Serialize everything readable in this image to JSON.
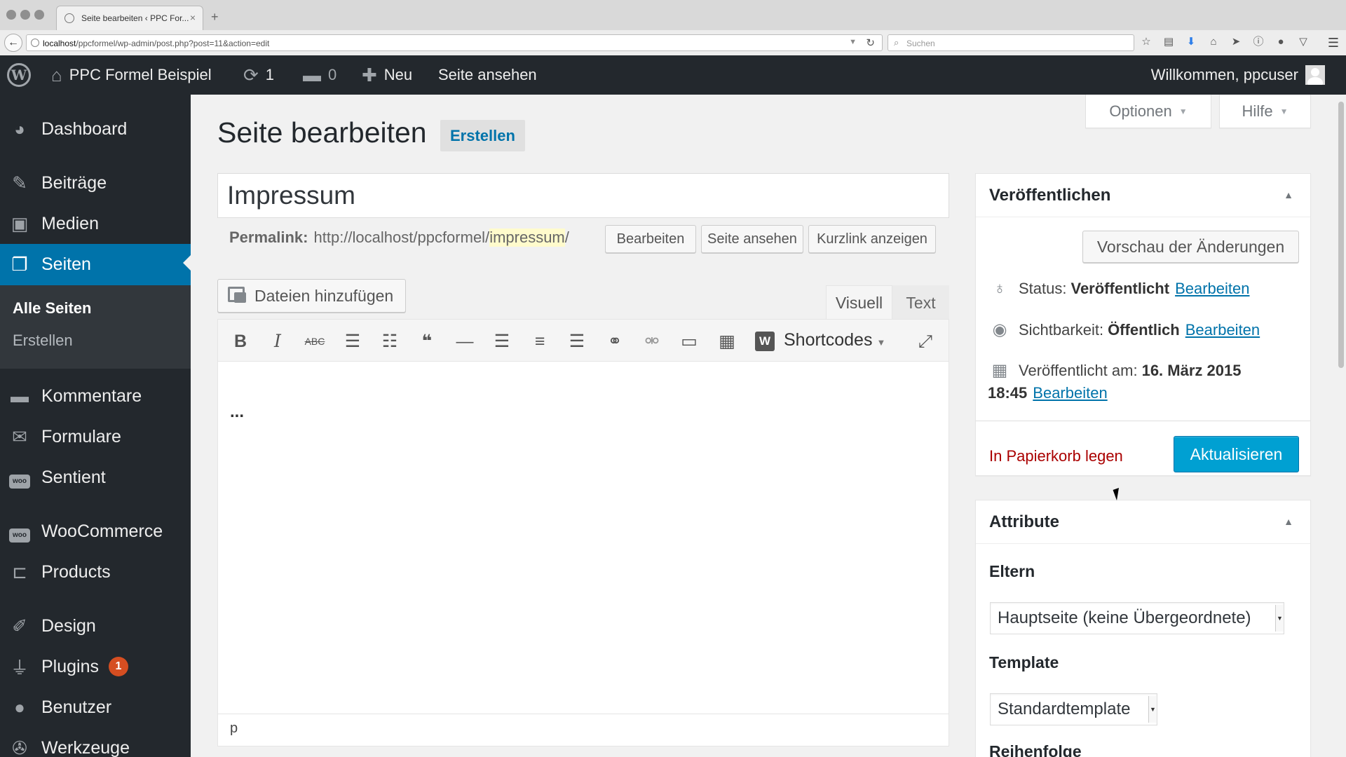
{
  "browser": {
    "tab_title": "Seite bearbeiten ‹ PPC For...",
    "tab_close": "×",
    "new_tab": "+",
    "back": "←",
    "url_host": "localhost",
    "url_path": "/ppcformel/wp-admin/post.php?post=11&action=edit",
    "search_placeholder": "Suchen",
    "reload": "↻"
  },
  "adminbar": {
    "wp_logo": "W",
    "site_name": "PPC Formel Beispiel",
    "updates_count": "1",
    "comments_count": "0",
    "new_label": "Neu",
    "view_page": "Seite ansehen",
    "greeting": "Willkommen, ppcuser"
  },
  "sidebar": {
    "items": [
      {
        "label": "Dashboard",
        "icon": "dashboard-icon"
      },
      {
        "label": "Beiträge",
        "icon": "pin-icon"
      },
      {
        "label": "Medien",
        "icon": "media-icon"
      },
      {
        "label": "Seiten",
        "icon": "pages-icon",
        "active": true
      },
      {
        "label": "Kommentare",
        "icon": "comment-icon"
      },
      {
        "label": "Formulare",
        "icon": "mail-icon"
      },
      {
        "label": "Sentient",
        "icon": "woo-icon"
      },
      {
        "label": "WooCommerce",
        "icon": "woo-icon"
      },
      {
        "label": "Products",
        "icon": "cart-icon"
      },
      {
        "label": "Design",
        "icon": "brush-icon"
      },
      {
        "label": "Plugins",
        "icon": "plugin-icon",
        "badge": "1"
      },
      {
        "label": "Benutzer",
        "icon": "user-icon"
      },
      {
        "label": "Werkzeuge",
        "icon": "wrench-icon"
      }
    ],
    "submenu": {
      "all_pages": "Alle Seiten",
      "create": "Erstellen"
    }
  },
  "header": {
    "options": "Optionen",
    "help": "Hilfe",
    "title": "Seite bearbeiten",
    "add_new": "Erstellen"
  },
  "editor": {
    "post_title": "Impressum",
    "permalink_label": "Permalink:",
    "permalink_base": "http://localhost/ppcformel/",
    "permalink_slug": "impressum",
    "permalink_end": "/",
    "edit_button": "Bearbeiten",
    "view_button": "Seite ansehen",
    "shortlink_button": "Kurzlink anzeigen",
    "add_media": "Dateien hinzufügen",
    "tab_visual": "Visuell",
    "tab_text": "Text",
    "shortcodes": "Shortcodes",
    "content": "...",
    "path": "p"
  },
  "publish": {
    "title": "Veröffentlichen",
    "preview": "Vorschau der Änderungen",
    "status_label": "Status:",
    "status_value": "Veröffentlicht",
    "visibility_label": "Sichtbarkeit:",
    "visibility_value": "Öffentlich",
    "published_label": "Veröffentlicht am:",
    "published_date": "16. März 2015",
    "published_time": "18:45",
    "edit_link": "Bearbeiten",
    "trash": "In Papierkorb legen",
    "update": "Aktualisieren"
  },
  "attributes": {
    "title": "Attribute",
    "parent_label": "Eltern",
    "parent_value": "Hauptseite (keine Übergeordnete)",
    "template_label": "Template",
    "template_value": "Standardtemplate",
    "order_label": "Reihenfolge"
  },
  "colors": {
    "admin_bar": "#23282d",
    "accent": "#0073aa",
    "primary_button": "#00a0d2",
    "trash": "#aa0000"
  }
}
